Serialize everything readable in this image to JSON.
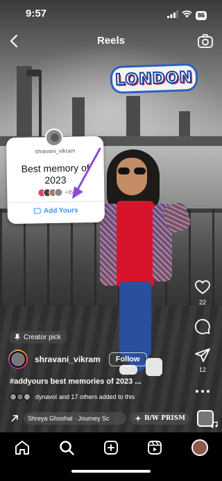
{
  "status_bar": {
    "time": "9:57",
    "battery": "86"
  },
  "header": {
    "title": "Reels"
  },
  "stickers": {
    "location": "LONDON",
    "add_yours": {
      "username": "shravani_vikram",
      "prompt": "Best memory of 2023",
      "participants_count": "+35",
      "button_label": "Add Yours"
    }
  },
  "actions": {
    "likes": "22",
    "shares": "12"
  },
  "post": {
    "badge": "Creator pick",
    "author": "shravani_vikram",
    "follow_label": "Follow",
    "caption": "#addyours best memories of 2023 ...",
    "added_by_user": "dynavol",
    "added_by_rest": "and 17 others added to this",
    "song": "Shreya Ghoshal · Journey Sc",
    "effect": "B/W PRISM"
  },
  "tabs": [
    "home",
    "search",
    "create",
    "reels",
    "profile"
  ]
}
